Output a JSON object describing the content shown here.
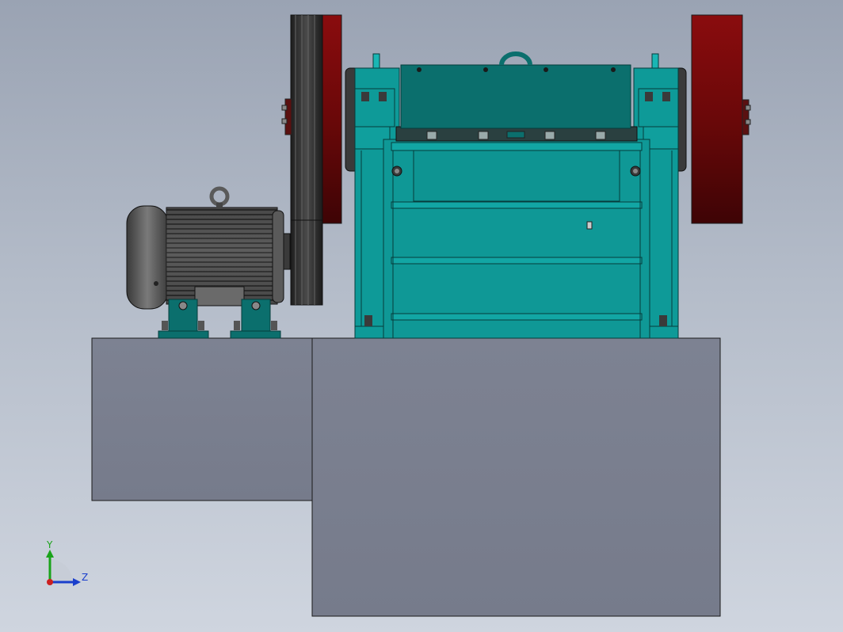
{
  "viewport": {
    "background_top": "#9aa3b3",
    "background_bottom": "#cfd5df"
  },
  "model": {
    "machine_color": "#0e9a98",
    "machine_dark": "#0b6f6d",
    "flywheel_color": "#7a0a0c",
    "motor_color": "#4a4a4a",
    "base_color": "#7a7f8e"
  },
  "triad": {
    "y_label": "Y",
    "z_label": "Z",
    "y_color": "#1aa31a",
    "z_color": "#1a3fcc",
    "origin_color": "#cc2020"
  }
}
